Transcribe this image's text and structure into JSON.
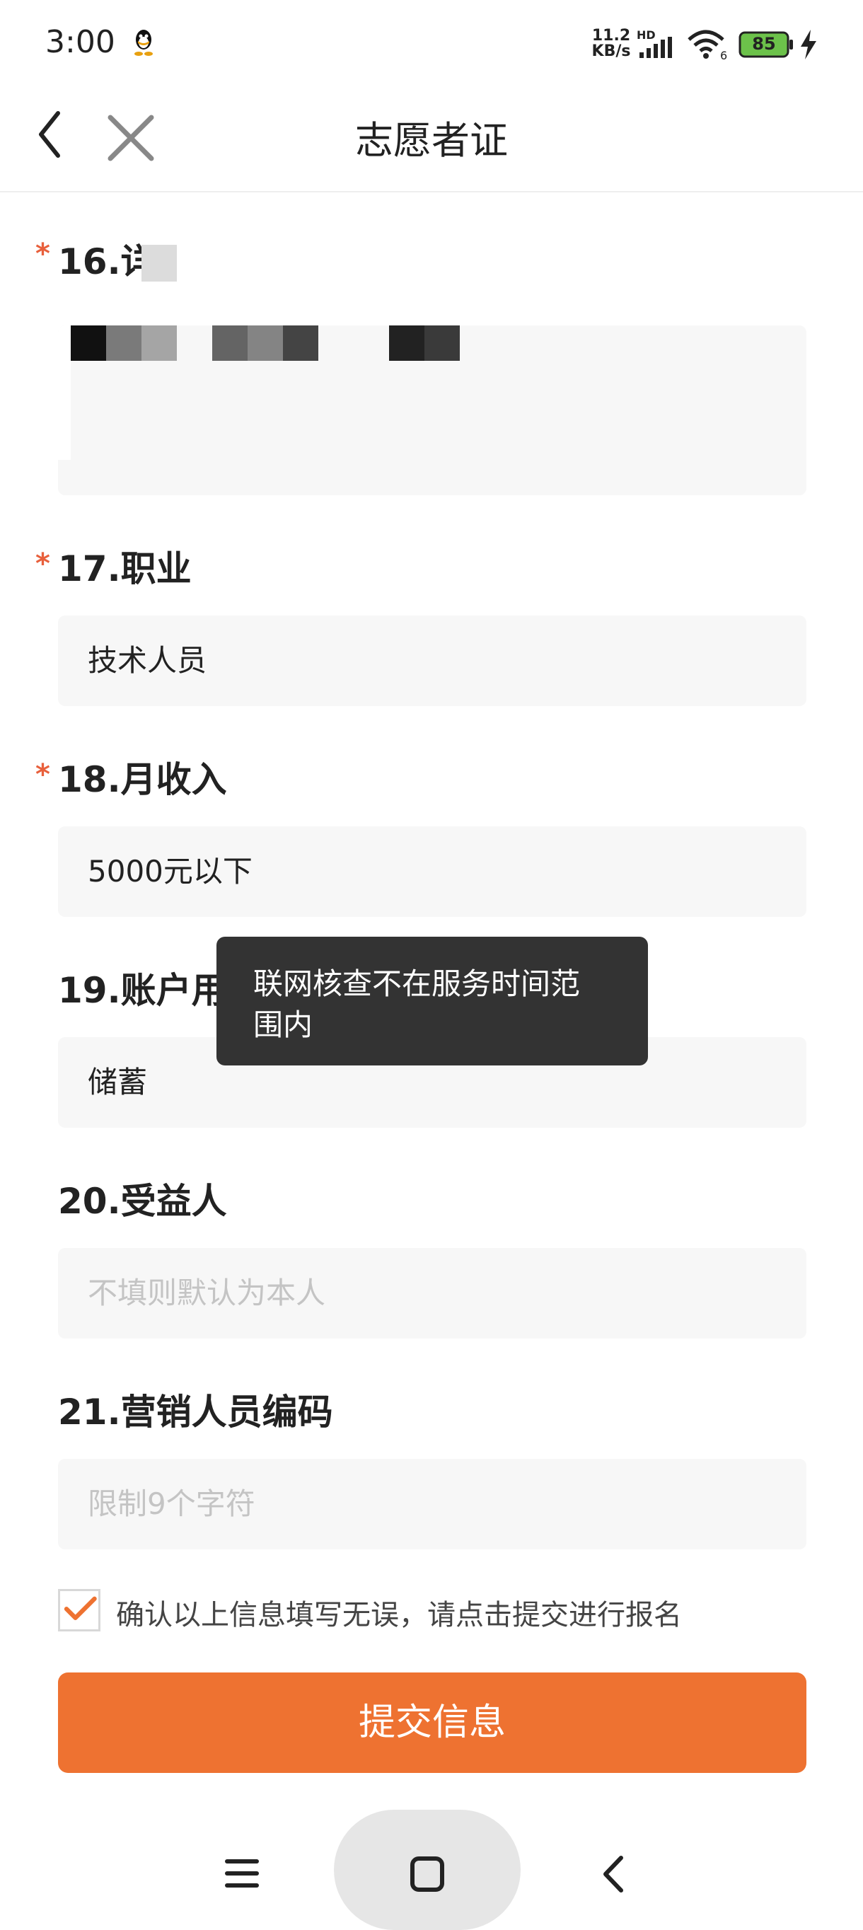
{
  "status_bar": {
    "time": "3:00",
    "net_speed_value": "11.2",
    "net_speed_unit": "KB/s",
    "hd": "HD",
    "battery": "85",
    "icons": [
      "qq-icon",
      "signal-icon",
      "wifi-icon",
      "battery-icon",
      "charging-icon"
    ]
  },
  "nav": {
    "title": "志愿者证",
    "back_icon": "chevron-left-icon",
    "close_icon": "close-icon"
  },
  "form": {
    "fields": [
      {
        "label": "16.详细",
        "required": true,
        "value": ""
      },
      {
        "label": "17.职业",
        "required": true,
        "value": "技术人员"
      },
      {
        "label": "18.月收入",
        "required": true,
        "value": "5000元以下"
      },
      {
        "label": "19.账户用途",
        "required": false,
        "value": "储蓄"
      },
      {
        "label": "20.受益人",
        "required": false,
        "placeholder": "不填则默认为本人"
      },
      {
        "label": "21.营销人员编码",
        "required": false,
        "placeholder": "限制9个字符"
      }
    ],
    "required_mark": "*",
    "agree": {
      "checked": true,
      "text": "确认以上信息填写无误，请点击提交进行报名"
    },
    "submit_label": "提交信息"
  },
  "toast": {
    "line1": "联网核查不在服务时间范",
    "line2": "围内"
  },
  "system_nav": {
    "icons": [
      "menu-icon",
      "home-icon",
      "back-icon"
    ]
  },
  "colors": {
    "accent": "#EE7231",
    "required": "#E8603C",
    "toast_bg": "#333333",
    "field_bg": "#F7F7F7"
  }
}
